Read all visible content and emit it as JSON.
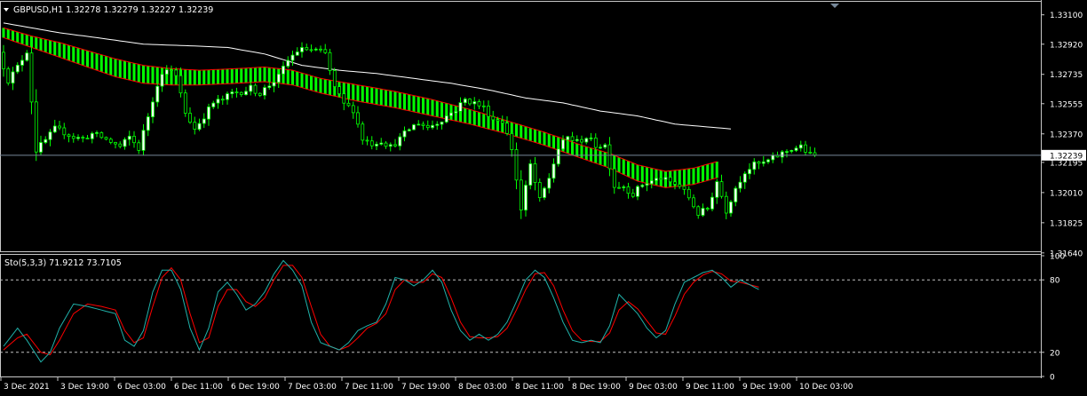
{
  "colors": {
    "background": "#000000",
    "frame": "#c8c8c8",
    "text": "#ffffff",
    "bull_candle": "#ffffff",
    "bear_candle": "#000000",
    "wick": "#00ff00",
    "band_fill": "#00ff00",
    "band_edge": "#ff0000",
    "ma_line": "#ffffff",
    "price_line": "#778899",
    "stoch_main": "#20b2aa",
    "stoch_signal": "#ff0000",
    "stoch_level": "#c0c0c0"
  },
  "main_panel": {
    "title": "GBPUSD,H1  1.32278 1.32279 1.32227 1.32239",
    "current_price_label": "1.32239"
  },
  "sub_panel": {
    "title": "Sto(5,3,3) 71.9212 73.7105"
  },
  "chart_data": [
    {
      "type": "candlestick",
      "symbol": "GBPUSD",
      "timeframe": "H1",
      "ohlc_last": {
        "open": 1.32278,
        "high": 1.32279,
        "low": 1.32227,
        "close": 1.32239
      },
      "ylim": [
        1.3165,
        1.3318
      ],
      "y_ticks": [
        1.3164,
        1.31825,
        1.3201,
        1.32195,
        1.3237,
        1.32555,
        1.32735,
        1.3292,
        1.331
      ],
      "y_tick_labels": [
        "1.31640",
        "1.31825",
        "1.32010",
        "1.32195",
        "1.32370",
        "1.32555",
        "1.32735",
        "1.32920",
        "1.33100"
      ],
      "current_price": 1.32239,
      "x_labels": [
        "3 Dec 2021",
        "3 Dec 19:00",
        "6 Dec 03:00",
        "6 Dec 11:00",
        "6 Dec 19:00",
        "7 Dec 03:00",
        "7 Dec 11:00",
        "7 Dec 19:00",
        "8 Dec 03:00",
        "8 Dec 11:00",
        "8 Dec 19:00",
        "9 Dec 03:00",
        "9 Dec 11:00",
        "9 Dec 19:00",
        "10 Dec 03:00"
      ],
      "ma_anchors": [
        [
          0,
          1.3305
        ],
        [
          6,
          1.3302
        ],
        [
          12,
          1.3299
        ],
        [
          20,
          1.3296
        ],
        [
          30,
          1.3292
        ],
        [
          40,
          1.3291
        ],
        [
          48,
          1.329
        ],
        [
          56,
          1.3286
        ],
        [
          64,
          1.3279
        ],
        [
          72,
          1.3276
        ],
        [
          80,
          1.3274
        ],
        [
          88,
          1.3271
        ],
        [
          96,
          1.3268
        ],
        [
          104,
          1.3264
        ],
        [
          112,
          1.3259
        ],
        [
          120,
          1.3256
        ],
        [
          128,
          1.3251
        ],
        [
          136,
          1.3248
        ],
        [
          144,
          1.3243
        ],
        [
          152,
          1.3241
        ],
        [
          156,
          1.324
        ]
      ],
      "band_upper_anchors": [
        [
          0,
          1.3302
        ],
        [
          6,
          1.3297
        ],
        [
          12,
          1.3293
        ],
        [
          18,
          1.3288
        ],
        [
          24,
          1.3283
        ],
        [
          30,
          1.3279
        ],
        [
          36,
          1.3277
        ],
        [
          42,
          1.3276
        ],
        [
          50,
          1.3277
        ],
        [
          56,
          1.3278
        ],
        [
          62,
          1.3276
        ],
        [
          68,
          1.3271
        ],
        [
          76,
          1.3267
        ],
        [
          84,
          1.3263
        ],
        [
          92,
          1.3258
        ],
        [
          100,
          1.3252
        ],
        [
          108,
          1.3245
        ],
        [
          116,
          1.3238
        ],
        [
          124,
          1.323
        ],
        [
          130,
          1.3225
        ],
        [
          136,
          1.3218
        ],
        [
          142,
          1.3214
        ],
        [
          148,
          1.3216
        ],
        [
          153,
          1.322
        ]
      ],
      "band_lower_anchors": [
        [
          0,
          1.3296
        ],
        [
          6,
          1.329
        ],
        [
          12,
          1.3284
        ],
        [
          18,
          1.3278
        ],
        [
          24,
          1.3272
        ],
        [
          30,
          1.3268
        ],
        [
          36,
          1.3267
        ],
        [
          42,
          1.3267
        ],
        [
          50,
          1.3268
        ],
        [
          56,
          1.3269
        ],
        [
          62,
          1.3267
        ],
        [
          68,
          1.3262
        ],
        [
          76,
          1.3257
        ],
        [
          84,
          1.3253
        ],
        [
          92,
          1.3248
        ],
        [
          100,
          1.3243
        ],
        [
          108,
          1.3237
        ],
        [
          116,
          1.323
        ],
        [
          124,
          1.3222
        ],
        [
          130,
          1.3216
        ],
        [
          136,
          1.3208
        ],
        [
          142,
          1.3204
        ],
        [
          148,
          1.3206
        ],
        [
          153,
          1.321
        ]
      ],
      "price_path": [
        [
          0,
          1.3287
        ],
        [
          2,
          1.327
        ],
        [
          4,
          1.3278
        ],
        [
          6,
          1.3288
        ],
        [
          8,
          1.3227
        ],
        [
          10,
          1.3233
        ],
        [
          12,
          1.324
        ],
        [
          14,
          1.3238
        ],
        [
          16,
          1.3235
        ],
        [
          18,
          1.3234
        ],
        [
          20,
          1.3237
        ],
        [
          22,
          1.3235
        ],
        [
          24,
          1.3232
        ],
        [
          26,
          1.3229
        ],
        [
          28,
          1.3235
        ],
        [
          30,
          1.3228
        ],
        [
          32,
          1.3248
        ],
        [
          34,
          1.3268
        ],
        [
          36,
          1.3278
        ],
        [
          38,
          1.3272
        ],
        [
          40,
          1.325
        ],
        [
          42,
          1.324
        ],
        [
          44,
          1.3248
        ],
        [
          46,
          1.3256
        ],
        [
          48,
          1.3258
        ],
        [
          50,
          1.3262
        ],
        [
          52,
          1.3263
        ],
        [
          54,
          1.3265
        ],
        [
          56,
          1.3262
        ],
        [
          58,
          1.3267
        ],
        [
          60,
          1.3272
        ],
        [
          62,
          1.3282
        ],
        [
          64,
          1.3288
        ],
        [
          66,
          1.3289
        ],
        [
          68,
          1.3288
        ],
        [
          70,
          1.3286
        ],
        [
          72,
          1.3265
        ],
        [
          74,
          1.3255
        ],
        [
          76,
          1.3252
        ],
        [
          78,
          1.3234
        ],
        [
          80,
          1.3231
        ],
        [
          82,
          1.3233
        ],
        [
          84,
          1.3229
        ],
        [
          86,
          1.3234
        ],
        [
          88,
          1.324
        ],
        [
          90,
          1.3244
        ],
        [
          92,
          1.3241
        ],
        [
          94,
          1.3244
        ],
        [
          96,
          1.3248
        ],
        [
          98,
          1.3252
        ],
        [
          100,
          1.3258
        ],
        [
          102,
          1.3256
        ],
        [
          104,
          1.3253
        ],
        [
          106,
          1.3246
        ],
        [
          108,
          1.3245
        ],
        [
          110,
          1.3228
        ],
        [
          112,
          1.319
        ],
        [
          114,
          1.3218
        ],
        [
          116,
          1.3196
        ],
        [
          118,
          1.321
        ],
        [
          120,
          1.3228
        ],
        [
          122,
          1.3235
        ],
        [
          124,
          1.3232
        ],
        [
          126,
          1.3235
        ],
        [
          128,
          1.323
        ],
        [
          130,
          1.323
        ],
        [
          132,
          1.3205
        ],
        [
          134,
          1.3205
        ],
        [
          136,
          1.32
        ],
        [
          138,
          1.3206
        ],
        [
          140,
          1.3208
        ],
        [
          142,
          1.321
        ],
        [
          144,
          1.3207
        ],
        [
          146,
          1.3205
        ],
        [
          148,
          1.3198
        ],
        [
          150,
          1.3188
        ],
        [
          152,
          1.3191
        ],
        [
          154,
          1.3208
        ],
        [
          156,
          1.319
        ],
        [
          158,
          1.3204
        ],
        [
          160,
          1.3214
        ],
        [
          162,
          1.3218
        ],
        [
          164,
          1.3219
        ],
        [
          166,
          1.3222
        ],
        [
          168,
          1.3225
        ],
        [
          170,
          1.3228
        ],
        [
          172,
          1.3229
        ],
        [
          174,
          1.3224
        ]
      ],
      "candle_count": 175
    },
    {
      "type": "line",
      "indicator": "Stochastic",
      "params": "5,3,3",
      "main_value": 71.9212,
      "signal_value": 73.7105,
      "ylim": [
        0,
        100
      ],
      "y_ticks": [
        0,
        20,
        80,
        100
      ],
      "y_tick_labels": [
        "0",
        "20",
        "80",
        "100"
      ],
      "levels": [
        20,
        80
      ],
      "main_anchors": [
        [
          0,
          25
        ],
        [
          3,
          40
        ],
        [
          5,
          30
        ],
        [
          8,
          12
        ],
        [
          10,
          20
        ],
        [
          12,
          40
        ],
        [
          15,
          60
        ],
        [
          18,
          58
        ],
        [
          21,
          55
        ],
        [
          24,
          52
        ],
        [
          26,
          30
        ],
        [
          28,
          25
        ],
        [
          30,
          38
        ],
        [
          32,
          70
        ],
        [
          34,
          88
        ],
        [
          36,
          88
        ],
        [
          38,
          72
        ],
        [
          40,
          40
        ],
        [
          42,
          22
        ],
        [
          44,
          40
        ],
        [
          46,
          70
        ],
        [
          48,
          78
        ],
        [
          50,
          68
        ],
        [
          52,
          55
        ],
        [
          54,
          60
        ],
        [
          56,
          70
        ],
        [
          58,
          85
        ],
        [
          60,
          96
        ],
        [
          62,
          88
        ],
        [
          64,
          75
        ],
        [
          66,
          45
        ],
        [
          68,
          28
        ],
        [
          70,
          25
        ],
        [
          72,
          22
        ],
        [
          74,
          28
        ],
        [
          76,
          38
        ],
        [
          78,
          42
        ],
        [
          80,
          45
        ],
        [
          82,
          60
        ],
        [
          84,
          82
        ],
        [
          86,
          80
        ],
        [
          88,
          75
        ],
        [
          90,
          80
        ],
        [
          92,
          88
        ],
        [
          94,
          78
        ],
        [
          96,
          55
        ],
        [
          98,
          38
        ],
        [
          100,
          30
        ],
        [
          102,
          35
        ],
        [
          104,
          30
        ],
        [
          106,
          35
        ],
        [
          108,
          45
        ],
        [
          110,
          62
        ],
        [
          112,
          80
        ],
        [
          114,
          88
        ],
        [
          116,
          82
        ],
        [
          118,
          65
        ],
        [
          120,
          45
        ],
        [
          122,
          30
        ],
        [
          124,
          28
        ],
        [
          126,
          30
        ],
        [
          128,
          28
        ],
        [
          130,
          42
        ],
        [
          132,
          68
        ],
        [
          134,
          60
        ],
        [
          136,
          52
        ],
        [
          138,
          40
        ],
        [
          140,
          32
        ],
        [
          142,
          38
        ],
        [
          144,
          60
        ],
        [
          146,
          78
        ],
        [
          148,
          82
        ],
        [
          150,
          86
        ],
        [
          152,
          88
        ],
        [
          154,
          82
        ],
        [
          156,
          74
        ],
        [
          158,
          80
        ],
        [
          160,
          76
        ],
        [
          162,
          72
        ]
      ],
      "signal_anchors": [
        [
          0,
          22
        ],
        [
          3,
          32
        ],
        [
          5,
          35
        ],
        [
          8,
          20
        ],
        [
          10,
          18
        ],
        [
          12,
          30
        ],
        [
          15,
          52
        ],
        [
          18,
          60
        ],
        [
          21,
          58
        ],
        [
          24,
          55
        ],
        [
          26,
          38
        ],
        [
          28,
          28
        ],
        [
          30,
          32
        ],
        [
          32,
          58
        ],
        [
          34,
          82
        ],
        [
          36,
          90
        ],
        [
          38,
          80
        ],
        [
          40,
          52
        ],
        [
          42,
          28
        ],
        [
          44,
          32
        ],
        [
          46,
          58
        ],
        [
          48,
          72
        ],
        [
          50,
          72
        ],
        [
          52,
          62
        ],
        [
          54,
          58
        ],
        [
          56,
          65
        ],
        [
          58,
          80
        ],
        [
          60,
          92
        ],
        [
          62,
          92
        ],
        [
          64,
          82
        ],
        [
          66,
          58
        ],
        [
          68,
          35
        ],
        [
          70,
          25
        ],
        [
          72,
          22
        ],
        [
          74,
          25
        ],
        [
          76,
          32
        ],
        [
          78,
          40
        ],
        [
          80,
          44
        ],
        [
          82,
          52
        ],
        [
          84,
          72
        ],
        [
          86,
          80
        ],
        [
          88,
          78
        ],
        [
          90,
          78
        ],
        [
          92,
          85
        ],
        [
          94,
          82
        ],
        [
          96,
          65
        ],
        [
          98,
          45
        ],
        [
          100,
          33
        ],
        [
          102,
          32
        ],
        [
          104,
          32
        ],
        [
          106,
          33
        ],
        [
          108,
          40
        ],
        [
          110,
          55
        ],
        [
          112,
          72
        ],
        [
          114,
          85
        ],
        [
          116,
          86
        ],
        [
          118,
          75
        ],
        [
          120,
          55
        ],
        [
          122,
          38
        ],
        [
          124,
          30
        ],
        [
          126,
          29
        ],
        [
          128,
          29
        ],
        [
          130,
          36
        ],
        [
          132,
          55
        ],
        [
          134,
          62
        ],
        [
          136,
          56
        ],
        [
          138,
          46
        ],
        [
          140,
          36
        ],
        [
          142,
          35
        ],
        [
          144,
          50
        ],
        [
          146,
          68
        ],
        [
          148,
          78
        ],
        [
          150,
          84
        ],
        [
          152,
          87
        ],
        [
          154,
          85
        ],
        [
          156,
          79
        ],
        [
          158,
          78
        ],
        [
          160,
          76
        ],
        [
          162,
          74
        ]
      ]
    }
  ]
}
